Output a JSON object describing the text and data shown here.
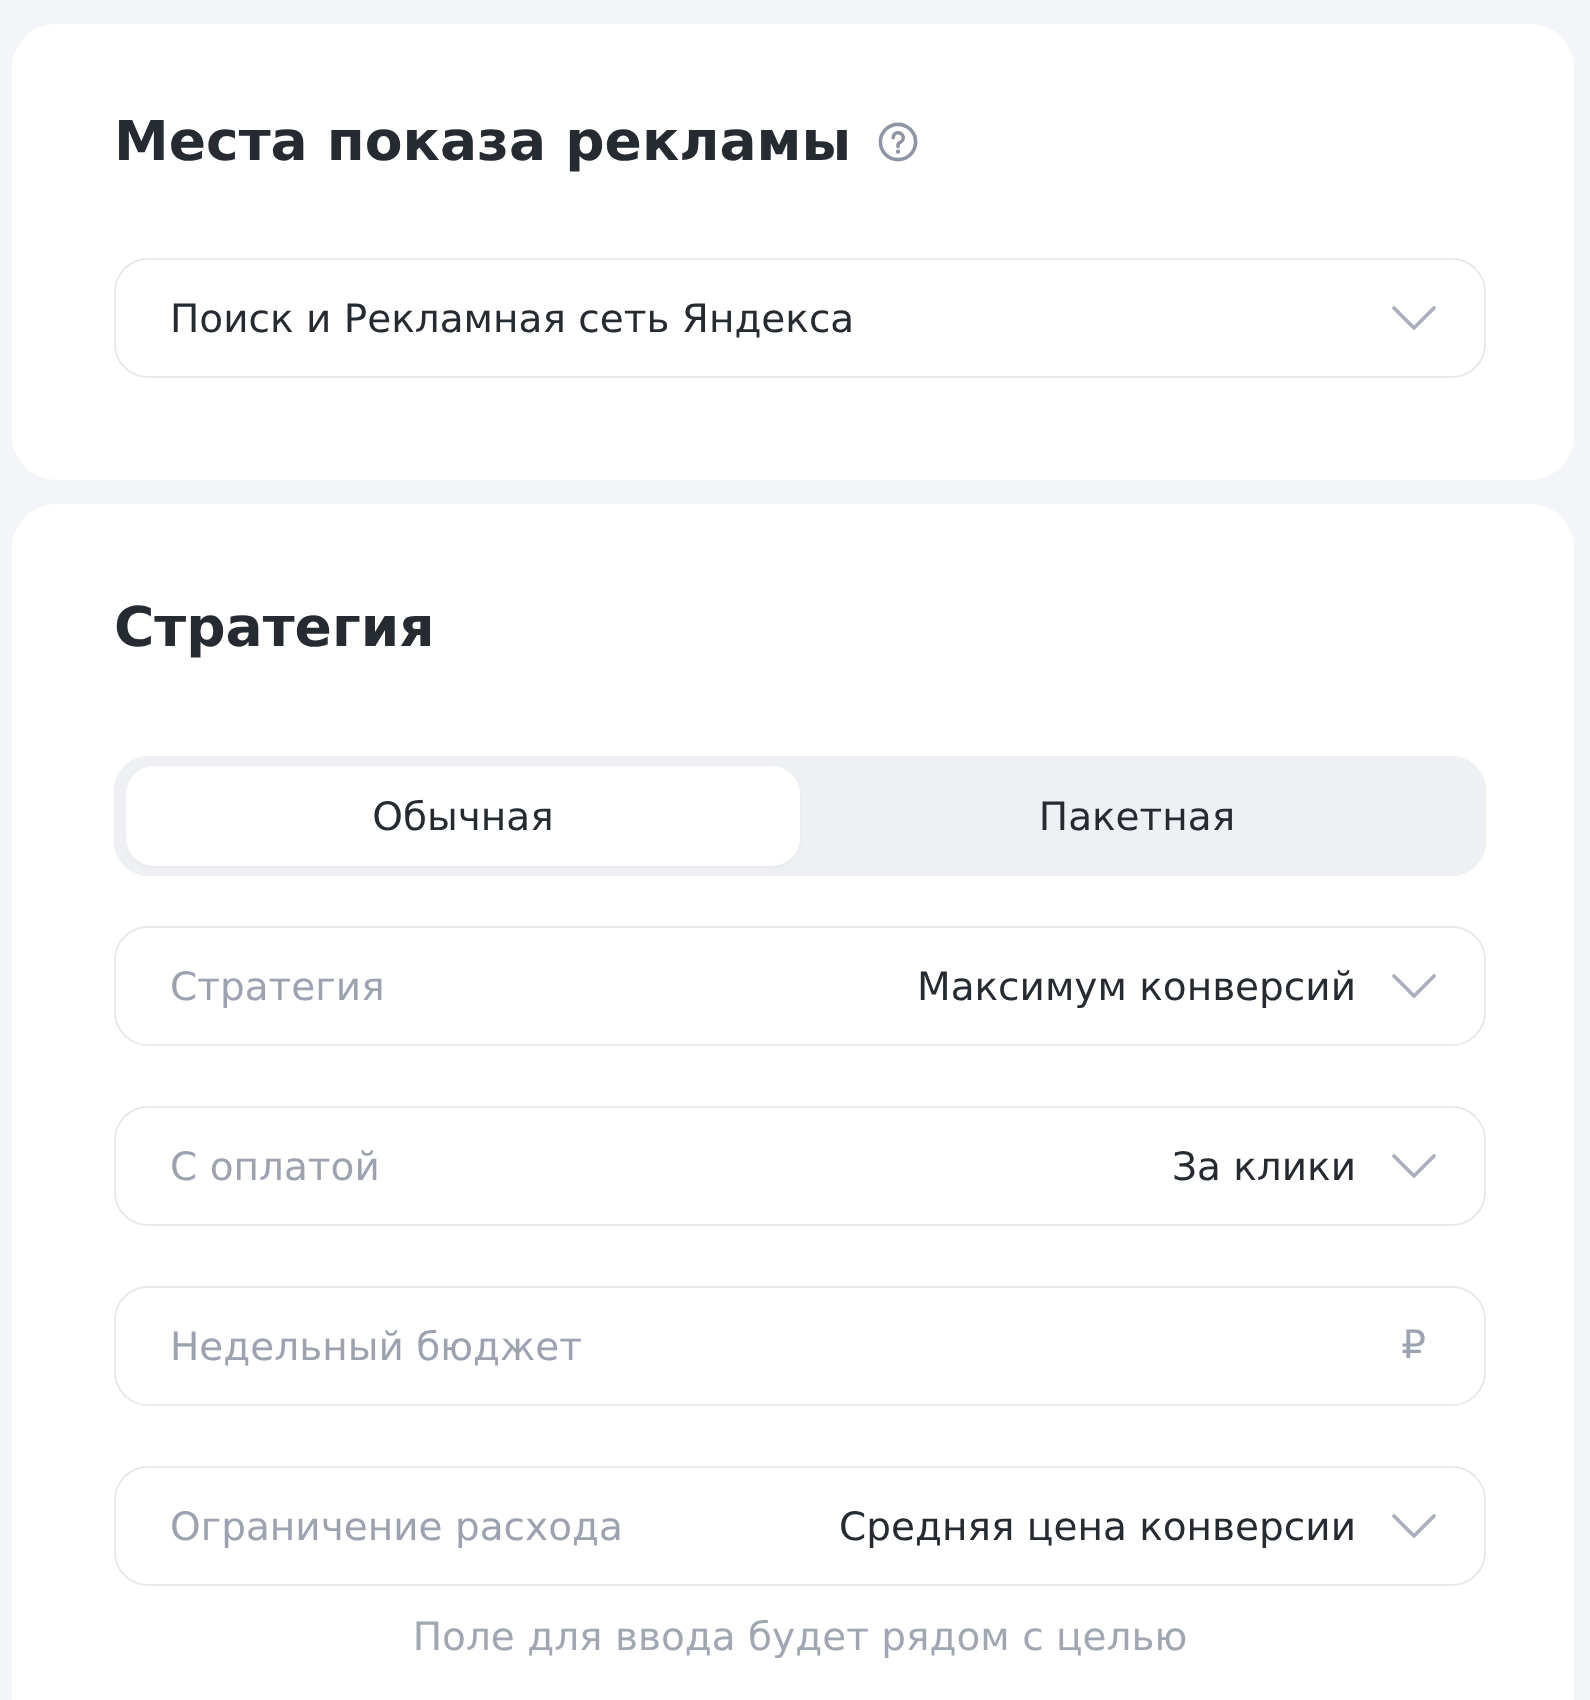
{
  "placements": {
    "title": "Места показа рекламы",
    "help": true,
    "select": {
      "value": "Поиск и Рекламная сеть Яндекса"
    }
  },
  "strategy": {
    "title": "Стратегия",
    "tabs": [
      {
        "label": "Обычная",
        "selected": true
      },
      {
        "label": "Пакетная",
        "selected": false
      }
    ],
    "fields": [
      {
        "kind": "select",
        "label": "Стратегия",
        "value": "Максимум конверсий"
      },
      {
        "kind": "select",
        "label": "С оплатой",
        "value": "За клики"
      },
      {
        "kind": "input",
        "placeholder": "Недельный бюджет",
        "suffix": "₽"
      },
      {
        "kind": "select",
        "label": "Ограничение расхода",
        "value": "Средняя цена конверсии"
      }
    ],
    "hint": "Поле для ввода будет рядом с целью"
  }
}
